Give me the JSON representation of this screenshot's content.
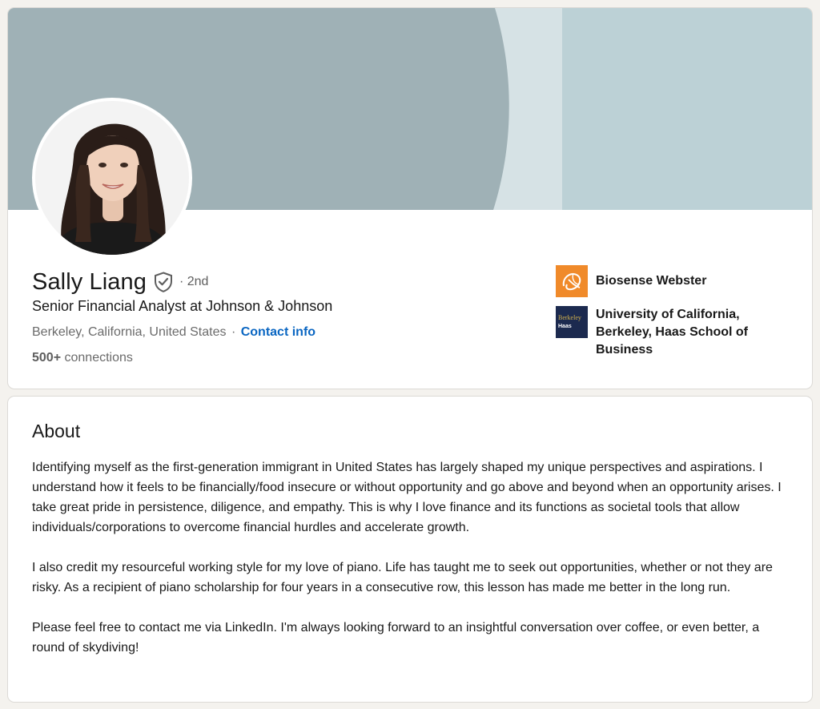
{
  "profile": {
    "name": "Sally Liang",
    "degree": "· 2nd",
    "headline": "Senior Financial Analyst at Johnson & Johnson",
    "location": "Berkeley, California, United States",
    "location_separator": "·",
    "contact_label": "Contact info",
    "connections_count": "500+",
    "connections_label": "connections"
  },
  "organizations": {
    "company": {
      "name": "Biosense Webster",
      "logo_icon": "biosense-webster-logo",
      "logo_color": "#f08a2a"
    },
    "school": {
      "name": "University of California, Berkeley, Haas School of Business",
      "logo_icon": "berkeley-haas-logo",
      "logo_color": "#1c2a4f",
      "logo_text_line1": "Berkeley",
      "logo_text_line2": "Haas"
    }
  },
  "about": {
    "title": "About",
    "paragraphs": [
      "Identifying myself as the first-generation immigrant in United States has largely shaped my unique perspectives and aspirations. I understand how it feels to be financially/food insecure or without opportunity and go above and beyond when an opportunity arises. I take great pride in persistence, diligence, and empathy. This is why I love finance and its functions as societal tools that allow individuals/corporations to overcome financial hurdles and accelerate growth.",
      "I also credit my resourceful working style for my love of piano. Life has taught me to seek out opportunities, whether or not they are risky. As a recipient of piano scholarship for four years in a consecutive row, this lesson has made me better in the long run.",
      "Please feel free to contact me via LinkedIn. I'm always looking forward to an insightful conversation over coffee, or even better, a round of skydiving!"
    ]
  },
  "colors": {
    "link": "#0a66c2",
    "banner_left": "#9fb1b6",
    "banner_mid": "#d6e2e5",
    "banner_right": "#bcd1d6",
    "page_background": "#f4f2ee"
  },
  "icons": {
    "verification": "verified-shield-icon"
  }
}
